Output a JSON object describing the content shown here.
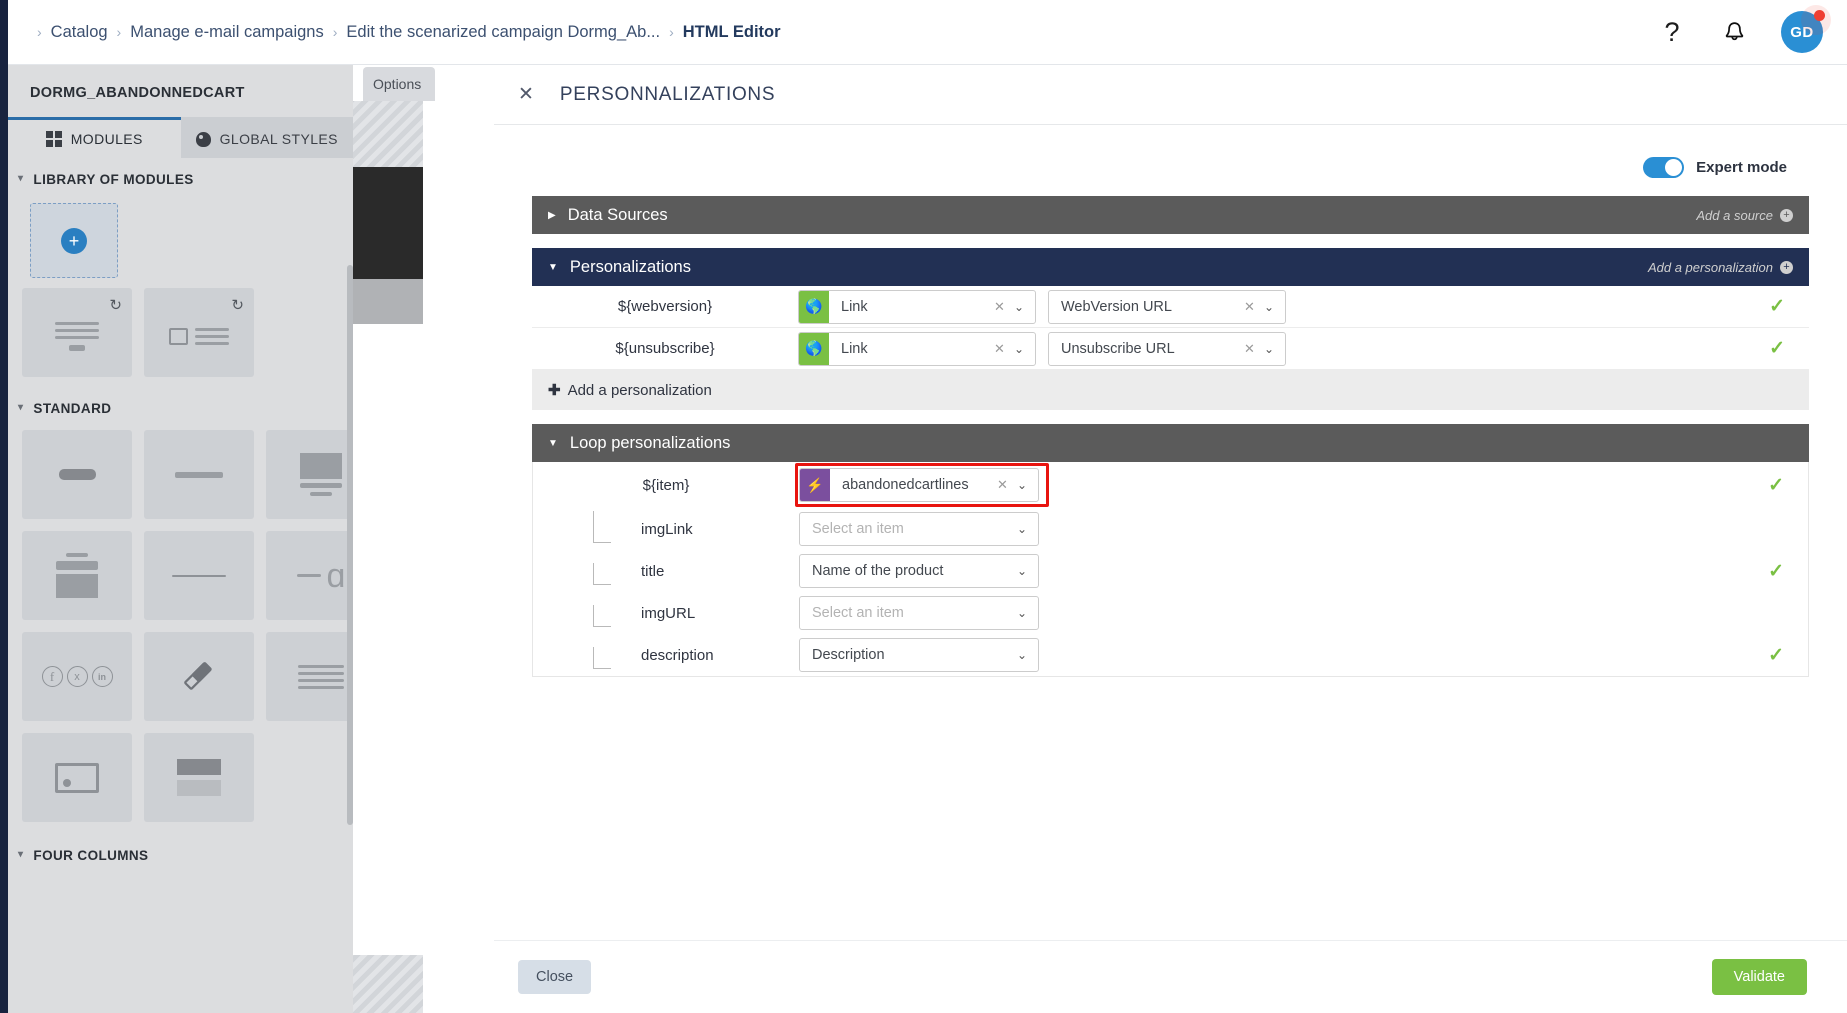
{
  "header": {
    "breadcrumb": [
      {
        "label": "Catalog",
        "current": false
      },
      {
        "label": "Manage e-mail campaigns",
        "current": false
      },
      {
        "label": "Edit the scenarized campaign Dormg_Ab...",
        "current": false
      },
      {
        "label": "HTML Editor",
        "current": true
      }
    ],
    "help_icon": "question-mark-icon",
    "bell_icon": "bell-icon",
    "avatar_initials": "GD"
  },
  "sidebar": {
    "title": "DORMG_ABANDONNEDCART",
    "tabs": [
      {
        "label": "MODULES",
        "icon": "grid-icon",
        "active": true
      },
      {
        "label": "GLOBAL STYLES",
        "icon": "palette-icon",
        "active": false
      }
    ],
    "sections": [
      {
        "label": "LIBRARY OF MODULES"
      },
      {
        "label": "STANDARD"
      },
      {
        "label": "FOUR COLUMNS"
      }
    ],
    "add_module_icon": "plus-circle-icon",
    "library_modules": [
      {
        "name": "text-block-module",
        "icon": "text-lines-icon"
      },
      {
        "name": "image-text-module",
        "icon": "image-text-icon"
      }
    ],
    "standard_modules": [
      {
        "name": "button-module",
        "icon": "button-icon"
      },
      {
        "name": "divider-module",
        "icon": "thick-line-icon"
      },
      {
        "name": "image-caption-module",
        "icon": "image-caption-icon"
      },
      {
        "name": "header-image-module",
        "icon": "header-image-icon"
      },
      {
        "name": "separator-module",
        "icon": "thin-line-icon"
      },
      {
        "name": "text-image-module",
        "icon": "line-circle-icon"
      },
      {
        "name": "social-module",
        "icon": "social-networks-icon"
      },
      {
        "name": "custom-html-module",
        "icon": "ruler-pencil-icon"
      },
      {
        "name": "paragraph-module",
        "icon": "text-lines-icon"
      },
      {
        "name": "picture-module",
        "icon": "picture-icon"
      },
      {
        "name": "two-blocks-module",
        "icon": "two-blocks-icon"
      }
    ]
  },
  "editor": {
    "options_tab": "Options"
  },
  "modal": {
    "title": "PERSONNALIZATIONS",
    "close_icon": "close-icon",
    "expert_mode_label": "Expert mode",
    "expert_mode_on": true,
    "panels": {
      "data_sources": {
        "title": "Data Sources",
        "collapsed": true,
        "action_label": "Add a source"
      },
      "personalizations": {
        "title": "Personalizations",
        "collapsed": false,
        "action_label": "Add a personalization",
        "rows": [
          {
            "variable": "${webversion}",
            "type_value": "Link",
            "type_icon": "globe-icon",
            "target_value": "WebVersion URL",
            "valid": true
          },
          {
            "variable": "${unsubscribe}",
            "type_value": "Link",
            "type_icon": "globe-icon",
            "target_value": "Unsubscribe URL",
            "valid": true
          }
        ],
        "add_row_label": "Add a personalization"
      },
      "loop_personalizations": {
        "title": "Loop personalizations",
        "collapsed": false,
        "item": {
          "variable": "${item}",
          "value": "abandonedcartlines",
          "icon": "lightning-bolt-icon",
          "highlighted": true,
          "valid": true
        },
        "fields": [
          {
            "label": "imgLink",
            "value": "Select an item",
            "placeholder": true,
            "valid": false
          },
          {
            "label": "title",
            "value": "Name of the product",
            "placeholder": false,
            "valid": true
          },
          {
            "label": "imgURL",
            "value": "Select an item",
            "placeholder": true,
            "valid": false
          },
          {
            "label": "description",
            "value": "Description",
            "placeholder": false,
            "valid": true
          }
        ]
      }
    },
    "footer": {
      "close_label": "Close",
      "validate_label": "Validate"
    }
  },
  "colors": {
    "accent_blue": "#2a8fd4",
    "navy": "#223054",
    "gray_panel": "#5b5b5b",
    "green": "#7ac043",
    "purple": "#7b4f9e",
    "highlight_red": "#e8140f"
  }
}
